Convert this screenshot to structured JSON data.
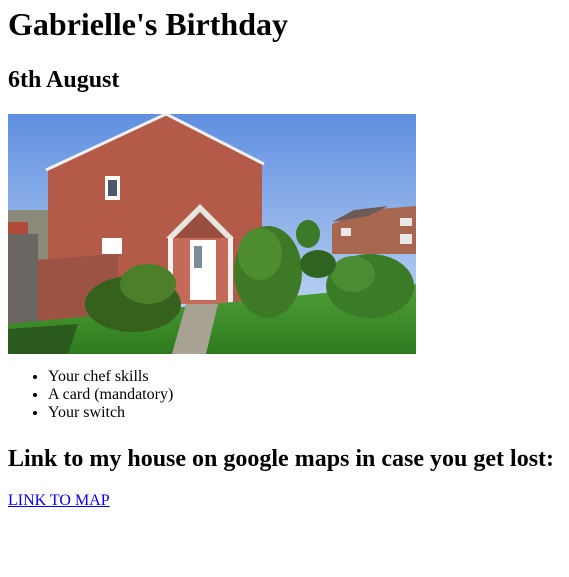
{
  "page": {
    "title": "Gabrielle's Birthday",
    "date": "6th August",
    "photo": {
      "description_icon": "house-photo"
    },
    "items": [
      "Your chef skills",
      "A card (mandatory)",
      "Your switch"
    ],
    "maps_heading": "Link to my house on google maps in case you get lost:",
    "map_link_label": "LINK TO MAP"
  },
  "colors": {
    "link": "#0000EE",
    "sky": "#7fa7e6",
    "brick": "#b5584a",
    "grass": "#3f8f2a"
  }
}
